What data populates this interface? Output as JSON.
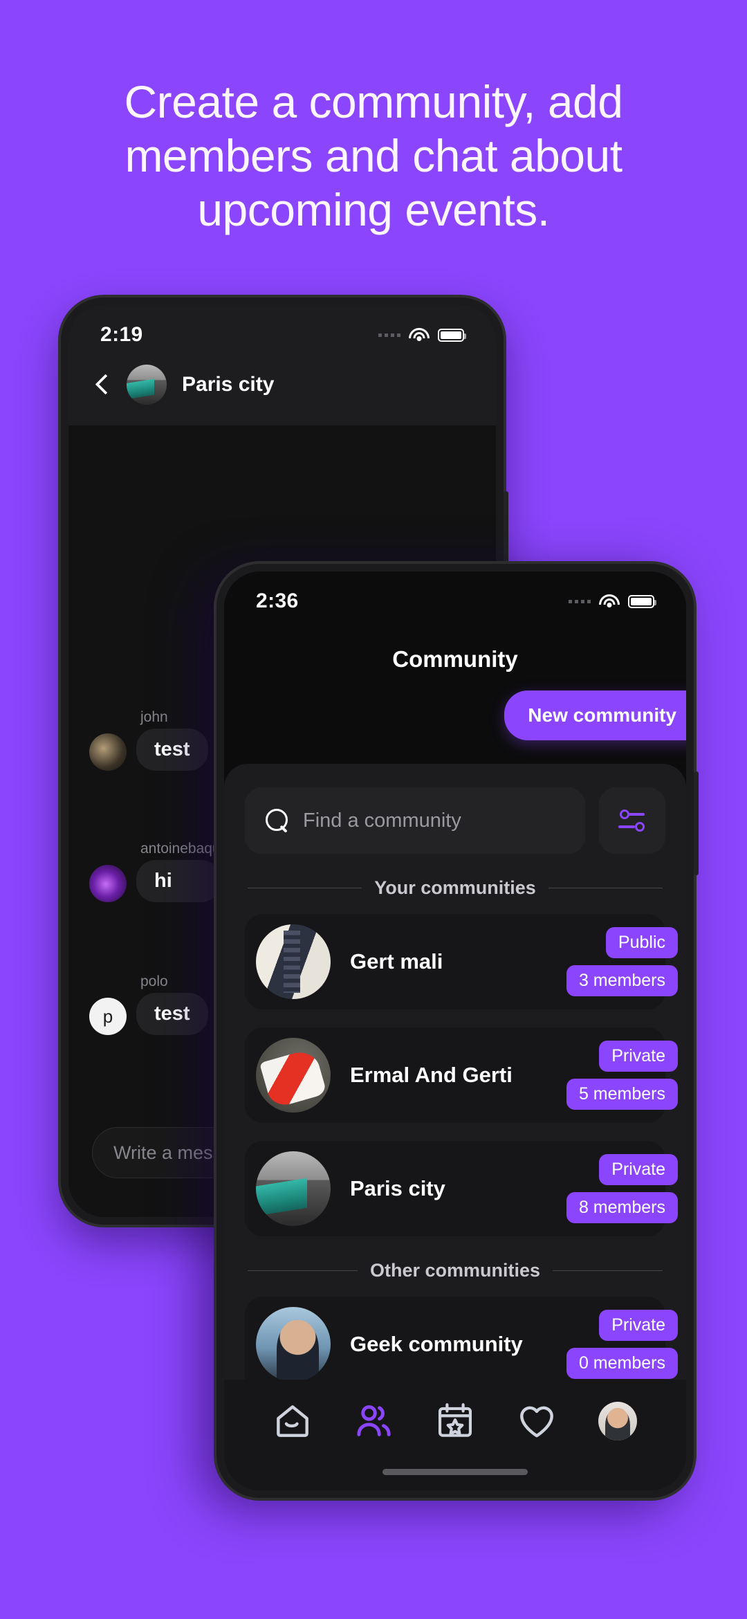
{
  "theme": {
    "background": "#8b45fc",
    "accent": "#8b45fc",
    "panel": "#1c1c1e",
    "card": "#161618",
    "screen": "#0c0c0d"
  },
  "headline": "Create a community, add members and chat about upcoming events.",
  "back_phone": {
    "status_bar": {
      "time": "2:19",
      "wifi": "wifi-icon",
      "battery": "battery-icon",
      "signal": "signal-dots-icon"
    },
    "header": {
      "back": "back-arrow-icon",
      "avatar": "paris-city-avatar",
      "title": "Paris city"
    },
    "messages": [
      {
        "name": "john",
        "text": "test",
        "avatar": "john-avatar"
      },
      {
        "name": "antoinebaqu",
        "text": "hi",
        "avatar": "antoine-avatar"
      },
      {
        "name": "polo",
        "text": "test",
        "avatar": "polo-avatar",
        "initial": "p"
      }
    ],
    "composer": {
      "placeholder": "Write a message..."
    }
  },
  "front_phone": {
    "status_bar": {
      "time": "2:36",
      "wifi": "wifi-icon",
      "battery": "battery-icon",
      "signal": "signal-dots-icon"
    },
    "title": "Community",
    "new_community_button": "New community",
    "search": {
      "placeholder": "Find a community",
      "icon": "search-icon"
    },
    "filter_button": {
      "icon": "filter-sliders-icon"
    },
    "sections": [
      {
        "label": "Your communities",
        "items": [
          {
            "name": "Gert mali",
            "visibility": "Public",
            "members": "3 members",
            "avatar": "remote-avatar"
          },
          {
            "name": "Ermal And Gerti",
            "visibility": "Private",
            "members": "5 members",
            "avatar": "roses-avatar"
          },
          {
            "name": "Paris city",
            "visibility": "Private",
            "members": "8 members",
            "avatar": "metro-avatar"
          }
        ]
      },
      {
        "label": "Other communities",
        "items": [
          {
            "name": "Geek community",
            "visibility": "Private",
            "members": "0 members",
            "avatar": "geek-avatar"
          }
        ]
      }
    ],
    "bottom_nav": [
      {
        "icon": "home-icon",
        "active": false
      },
      {
        "icon": "people-icon",
        "active": true
      },
      {
        "icon": "calendar-star-icon",
        "active": false
      },
      {
        "icon": "heart-icon",
        "active": false
      },
      {
        "icon": "profile-avatar-icon",
        "active": false
      }
    ]
  }
}
